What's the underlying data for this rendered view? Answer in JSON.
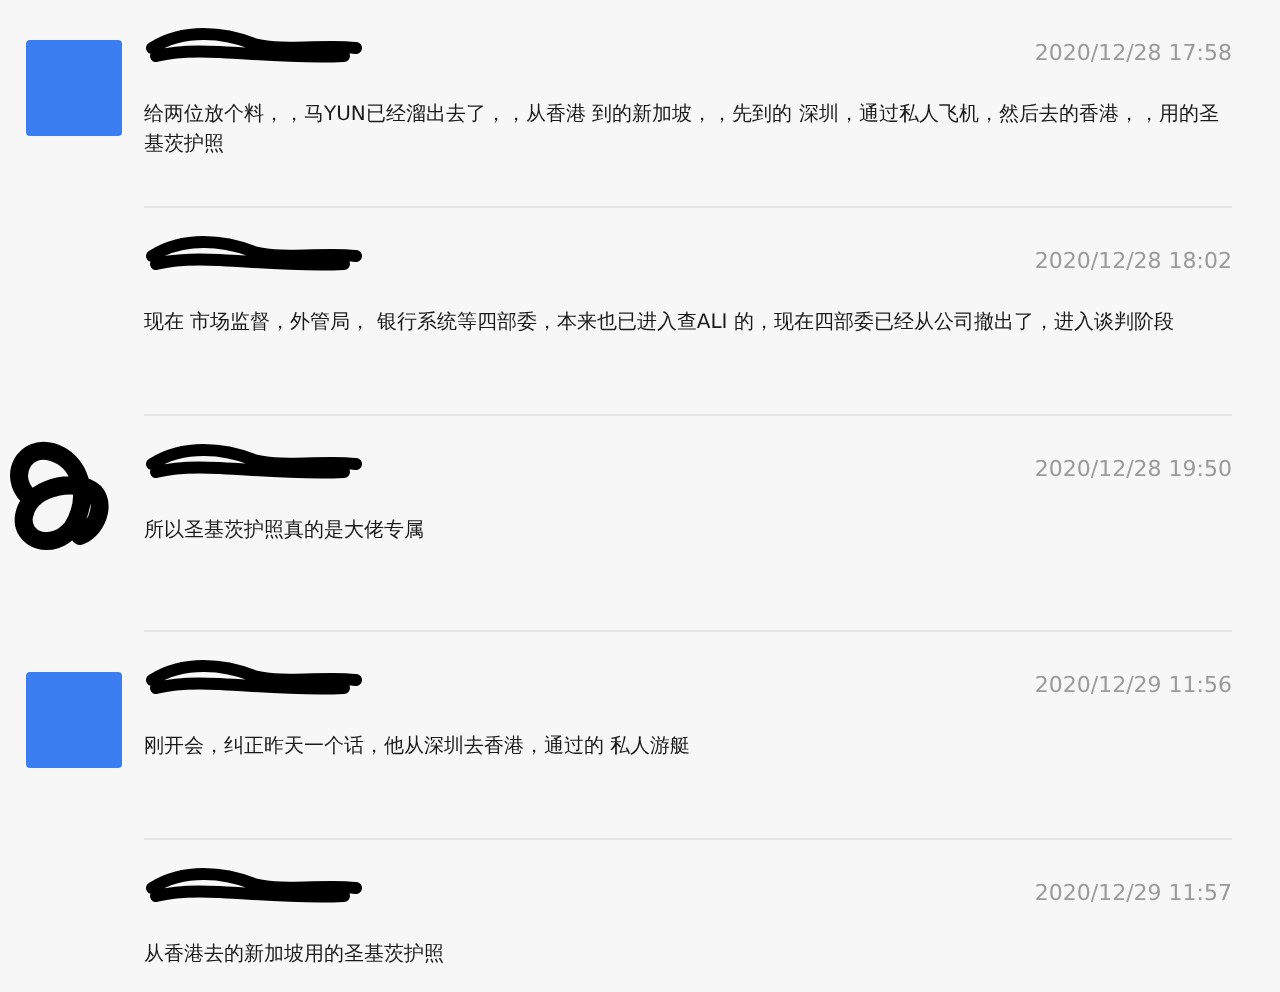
{
  "messages": [
    {
      "kind": "square",
      "time": "2020/12/28 17:58",
      "text": "给两位放个料，，马YUN已经溜出去了，，从香港 到的新加坡，，先到的 深圳，通过私人飞机，然后去的香港，，用的圣基茨护照"
    },
    {
      "kind": "follow",
      "time": "2020/12/28 18:02",
      "text": "现在 市场监督，外管局， 银行系统等四部委，本来也已进入查ALI 的，现在四部委已经从公司撤出了，进入谈判阶段"
    },
    {
      "kind": "redacted",
      "time": "2020/12/28 19:50",
      "text": "所以圣基茨护照真的是大佬专属"
    },
    {
      "kind": "square",
      "time": "2020/12/29 11:56",
      "text": "刚开会，纠正昨天一个话，他从深圳去香港，通过的 私人游艇"
    },
    {
      "kind": "follow",
      "time": "2020/12/29 11:57",
      "text": "从香港去的新加坡用的圣基茨护照"
    }
  ]
}
